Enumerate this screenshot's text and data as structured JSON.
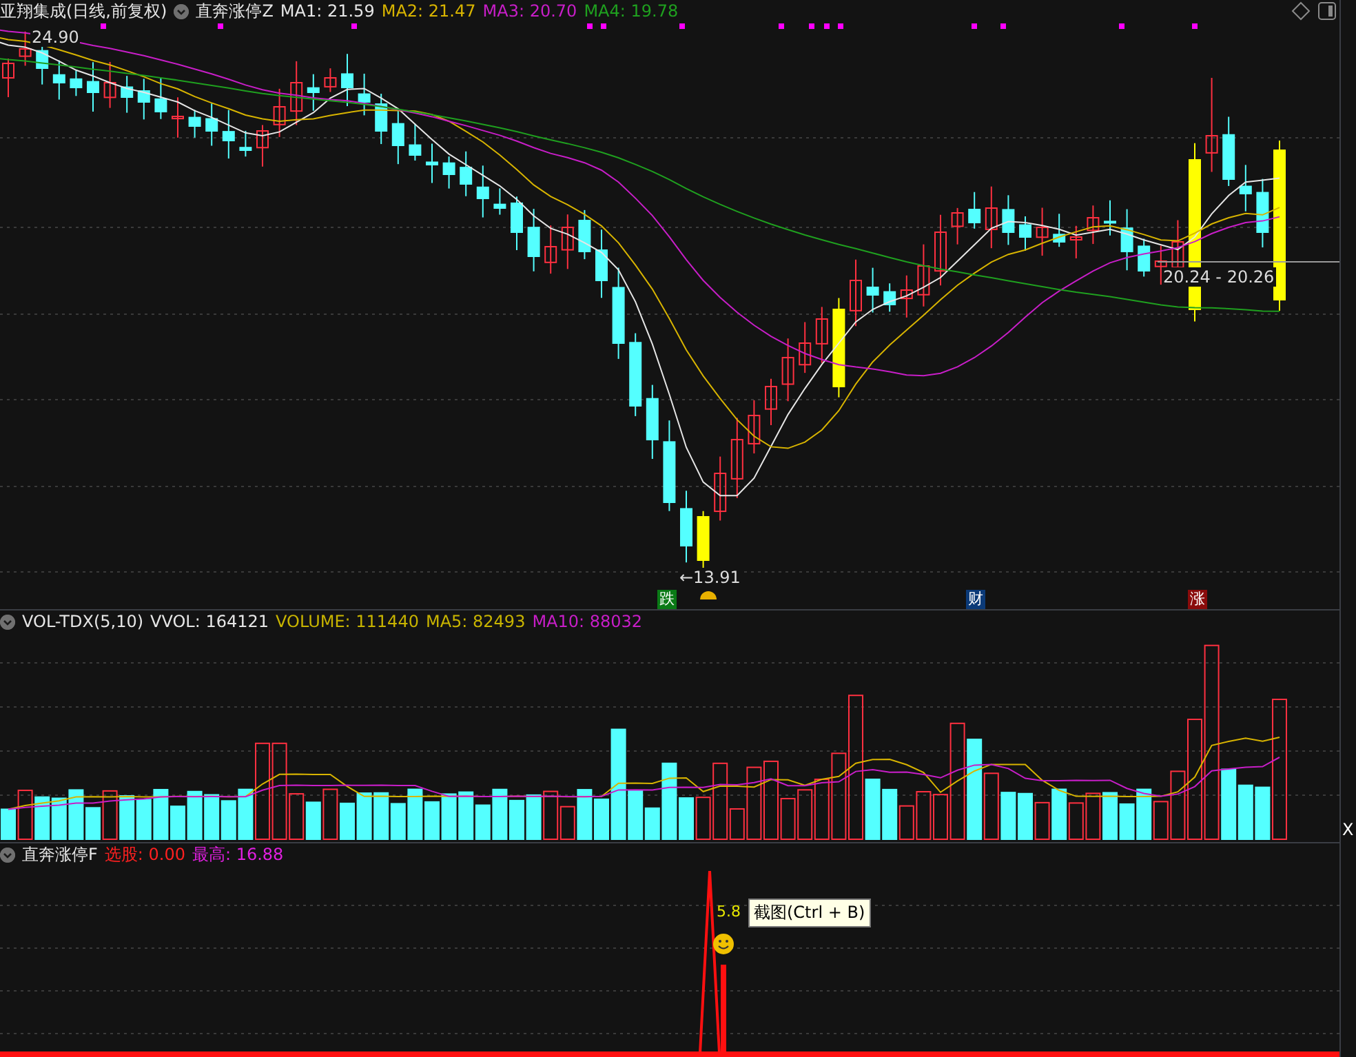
{
  "main_pane": {
    "stock_title": "亚翔集成(日线,前复权)",
    "indicator_name": "直奔涨停Z",
    "ma_values": [
      {
        "label": "MA1: 21.59",
        "color": "#e6e6e6"
      },
      {
        "label": "MA2: 21.47",
        "color": "#d8b400"
      },
      {
        "label": "MA3: 20.70",
        "color": "#c81ec8"
      },
      {
        "label": "MA4: 19.78",
        "color": "#1fa01f"
      }
    ],
    "high_label": "24.90",
    "low_label": "←13.91",
    "range_label": "20.24 - 20.26",
    "event_badges": [
      {
        "text": "跌",
        "color": "#0a7a16"
      },
      {
        "text": "财",
        "color": "#0b3a78"
      },
      {
        "text": "涨",
        "color": "#8a0b0b"
      }
    ]
  },
  "volume_pane": {
    "name": "VOL-TDX(5,10)",
    "values": [
      {
        "label": "VVOL: 164121",
        "color": "#e6e6e6"
      },
      {
        "label": "VOLUME: 111440",
        "color": "#c8b400"
      },
      {
        "label": "MA5: 82493",
        "color": "#c8b400"
      },
      {
        "label": "MA10: 88032",
        "color": "#c81ec8"
      }
    ],
    "axis_mark": "X"
  },
  "signal_pane": {
    "name": "直奔涨停F",
    "values": [
      {
        "label": "选股: 0.00",
        "color": "#ff2020"
      },
      {
        "label": "最高: 16.88",
        "color": "#e020e0"
      }
    ],
    "peak_label": "5.8",
    "tooltip": "截图(Ctrl + B)"
  }
}
